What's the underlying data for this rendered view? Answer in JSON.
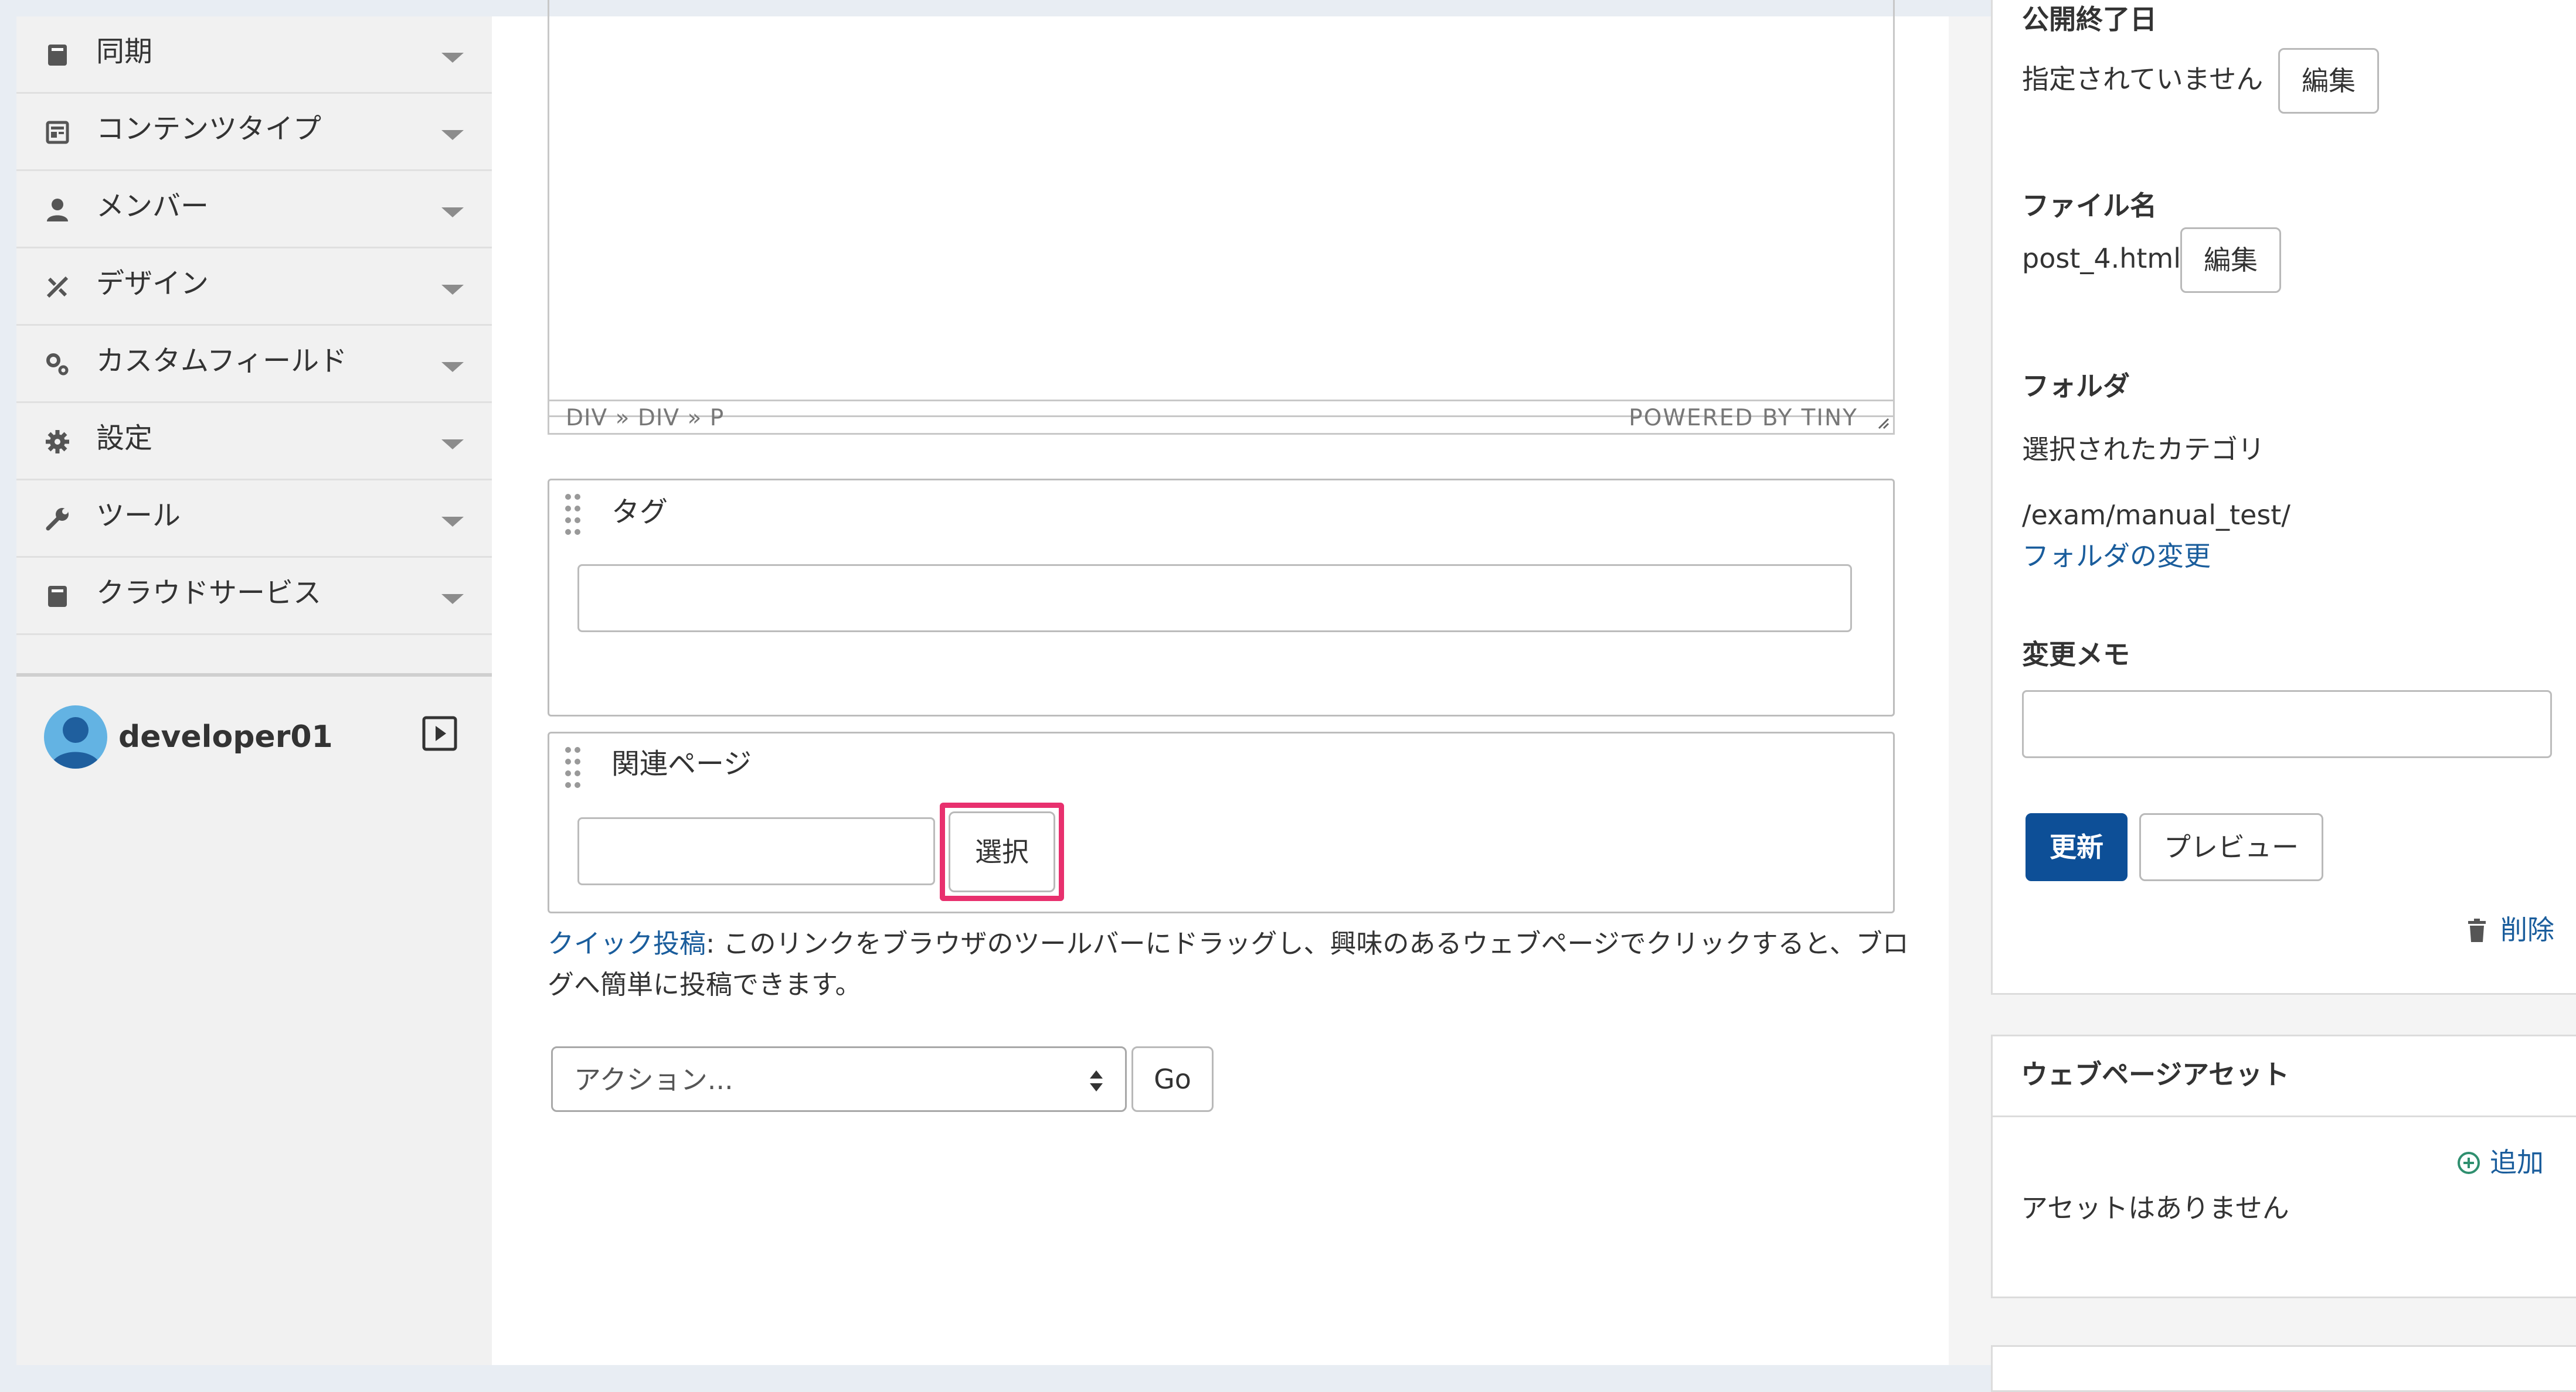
{
  "sidebar": {
    "items": [
      {
        "label": "同期",
        "icon": "sync-icon"
      },
      {
        "label": "コンテンツタイプ",
        "icon": "content-type-icon"
      },
      {
        "label": "メンバー",
        "icon": "member-icon"
      },
      {
        "label": "デザイン",
        "icon": "design-icon"
      },
      {
        "label": "カスタムフィールド",
        "icon": "custom-field-icon"
      },
      {
        "label": "設定",
        "icon": "gear-icon"
      },
      {
        "label": "ツール",
        "icon": "wrench-icon"
      },
      {
        "label": "クラウドサービス",
        "icon": "cloud-service-icon"
      }
    ],
    "user": {
      "name": "developer01"
    }
  },
  "editor": {
    "status_path": "DIV » DIV » P",
    "powered_by": "POWERED BY TINY"
  },
  "tags": {
    "title": "タグ",
    "value": ""
  },
  "related": {
    "title": "関連ページ",
    "value": "",
    "select_label": "選択"
  },
  "quick_post": {
    "link_label": "クイック投稿",
    "text": ": このリンクをブラウザのツールバーにドラッグし、興味のあるウェブページでクリックすると、ブログへ簡単に投稿できます。"
  },
  "action": {
    "placeholder": "アクション...",
    "go_label": "Go"
  },
  "publish_panel": {
    "end_date_label": "公開終了日",
    "end_date_value": "指定されていません",
    "edit_label": "編集",
    "filename_label": "ファイル名",
    "filename_value": "post_4.html",
    "folder_label": "フォルダ",
    "selected_category_label": "選択されたカテゴリ",
    "folder_path": "/exam/manual_test/",
    "change_folder_link": "フォルダの変更",
    "memo_label": "変更メモ",
    "memo_value": "",
    "update_label": "更新",
    "preview_label": "プレビュー",
    "delete_label": "削除"
  },
  "assets_panel": {
    "title": "ウェブページアセット",
    "add_label": "追加",
    "empty_text": "アセットはありません"
  },
  "colors": {
    "accent": "#0d4f97",
    "link": "#1a5d9c",
    "highlight": "#e8306e",
    "add_green": "#2f8f6f"
  }
}
